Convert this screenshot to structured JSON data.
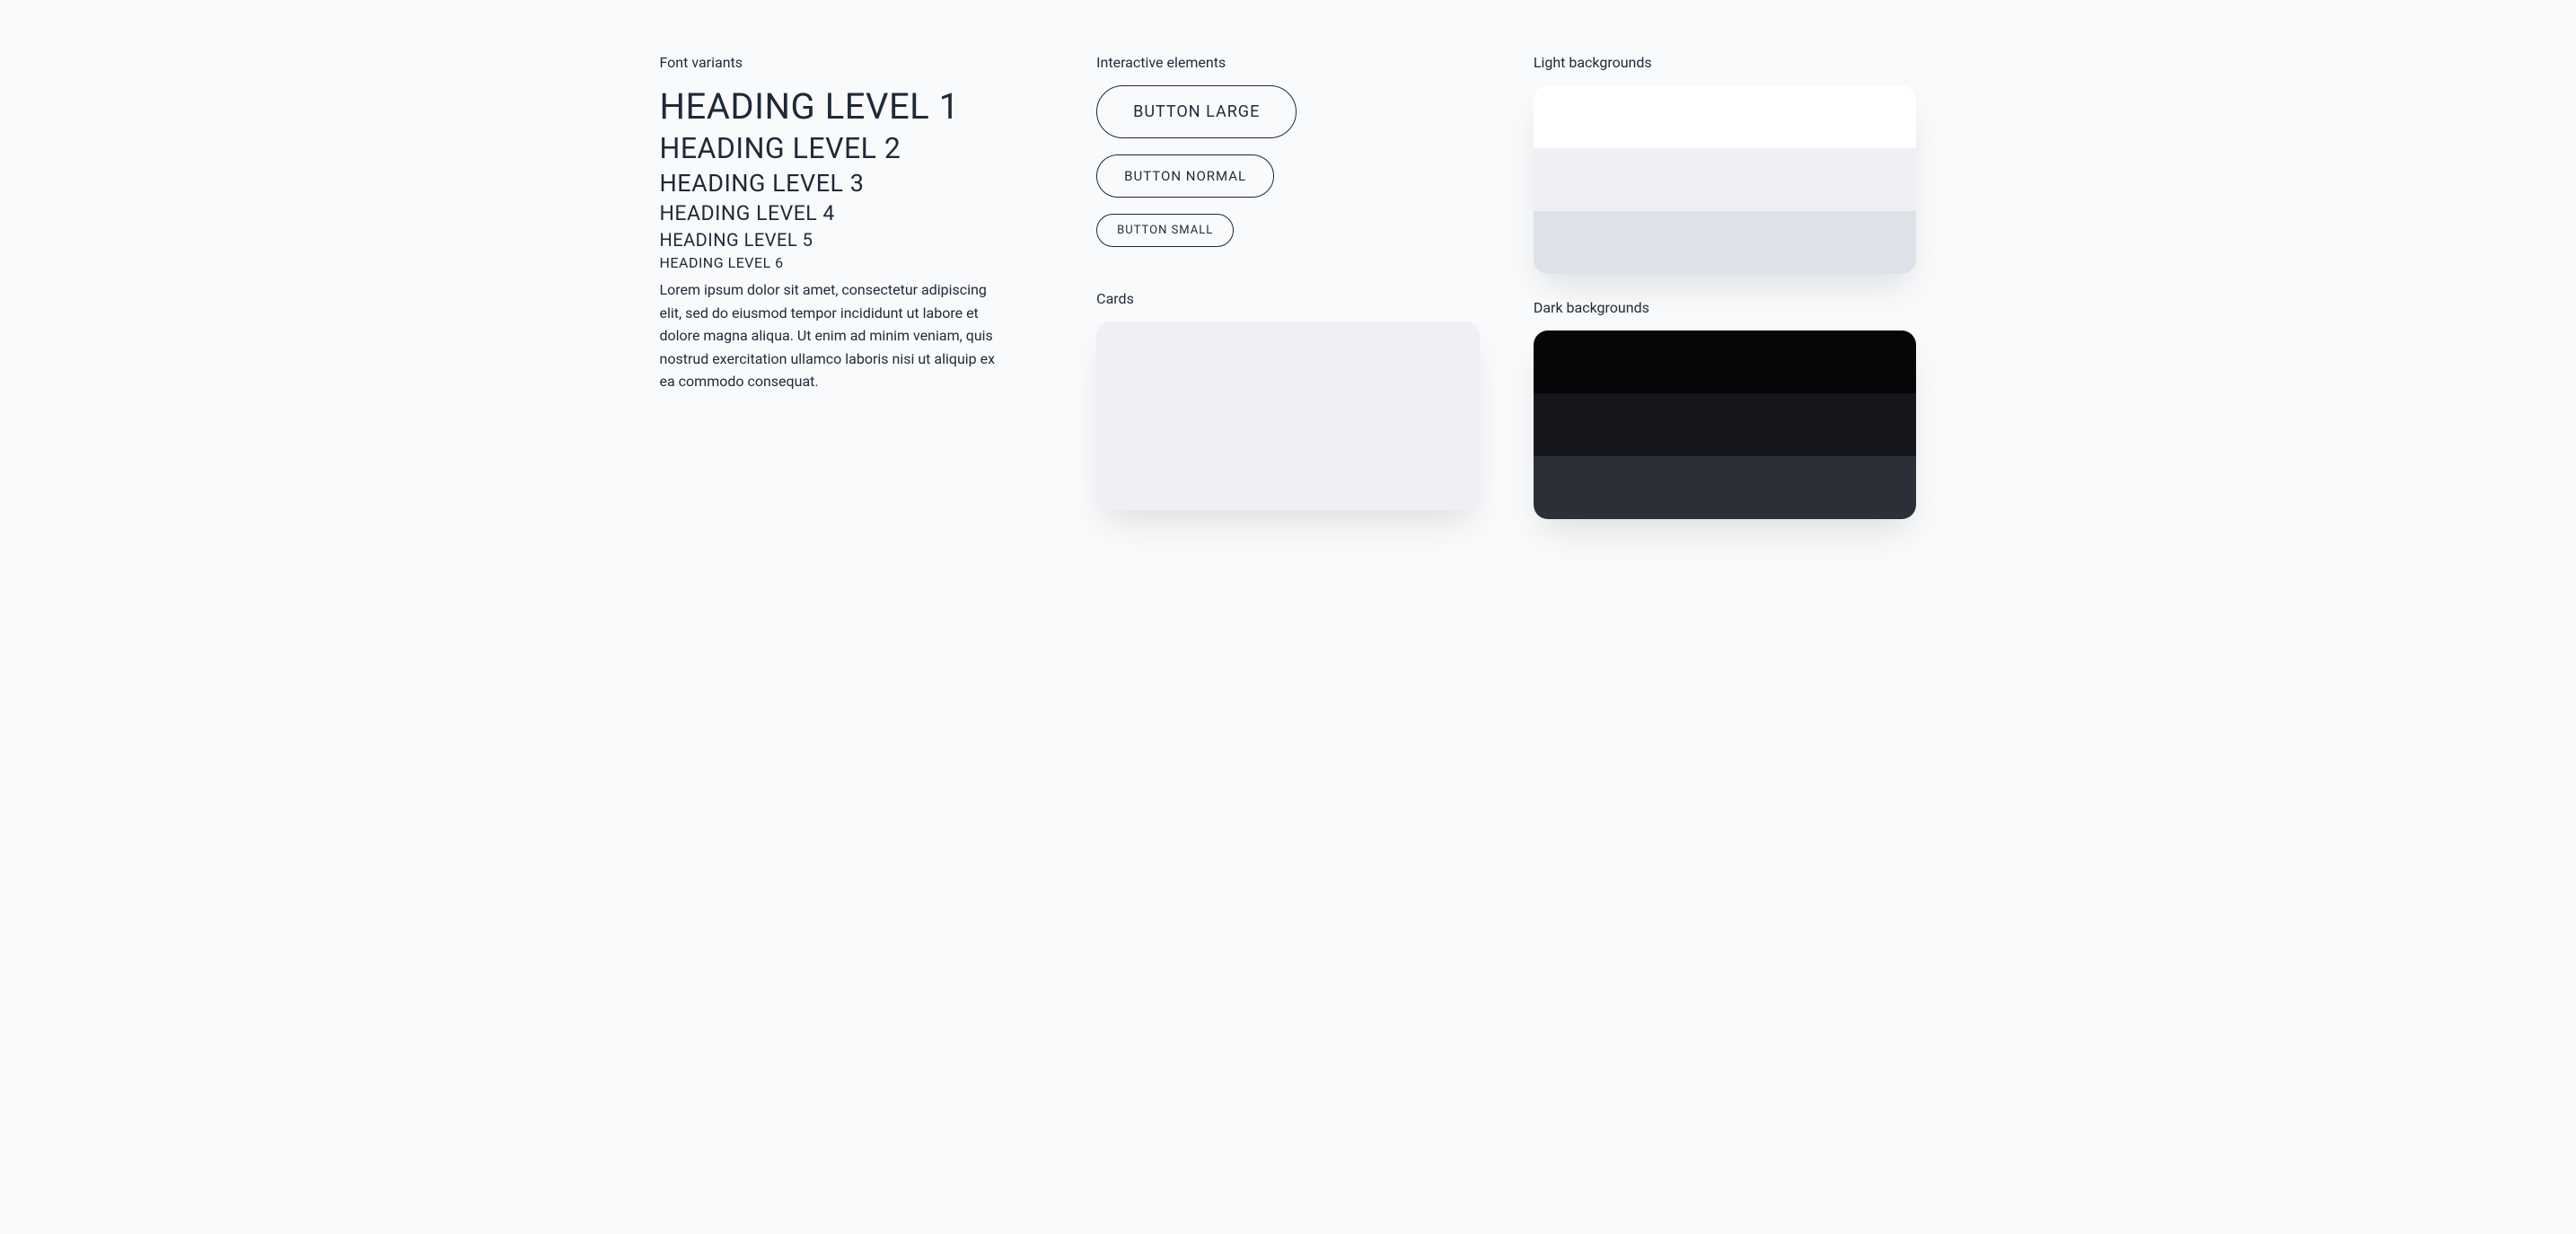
{
  "typography": {
    "section_label": "Font variants",
    "h1": "HEADING LEVEL 1",
    "h2": "HEADING LEVEL 2",
    "h3": "HEADING LEVEL 3",
    "h4": "HEADING LEVEL 4",
    "h5": "HEADING LEVEL 5",
    "h6": "HEADING LEVEL 6",
    "body_text": "Lorem ipsum dolor sit amet, consectetur adipiscing elit, sed do eiusmod tempor incididunt ut labore et dolore magna aliqua. Ut enim ad minim veniam, quis nostrud exercitation ullamco laboris nisi ut aliquip ex ea commodo consequat."
  },
  "interactive": {
    "section_label": "Interactive elements",
    "button_large": "BUTTON LARGE",
    "button_normal": "BUTTON NORMAL",
    "button_small": "BUTTON SMALL",
    "cards_label": "Cards"
  },
  "backgrounds": {
    "light_label": "Light backgrounds",
    "dark_label": "Dark backgrounds",
    "light_colors": [
      "#ffffff",
      "#eef0f3",
      "#dde2e8"
    ],
    "dark_colors": [
      "#050608",
      "#15171c",
      "#2b2f38"
    ]
  }
}
